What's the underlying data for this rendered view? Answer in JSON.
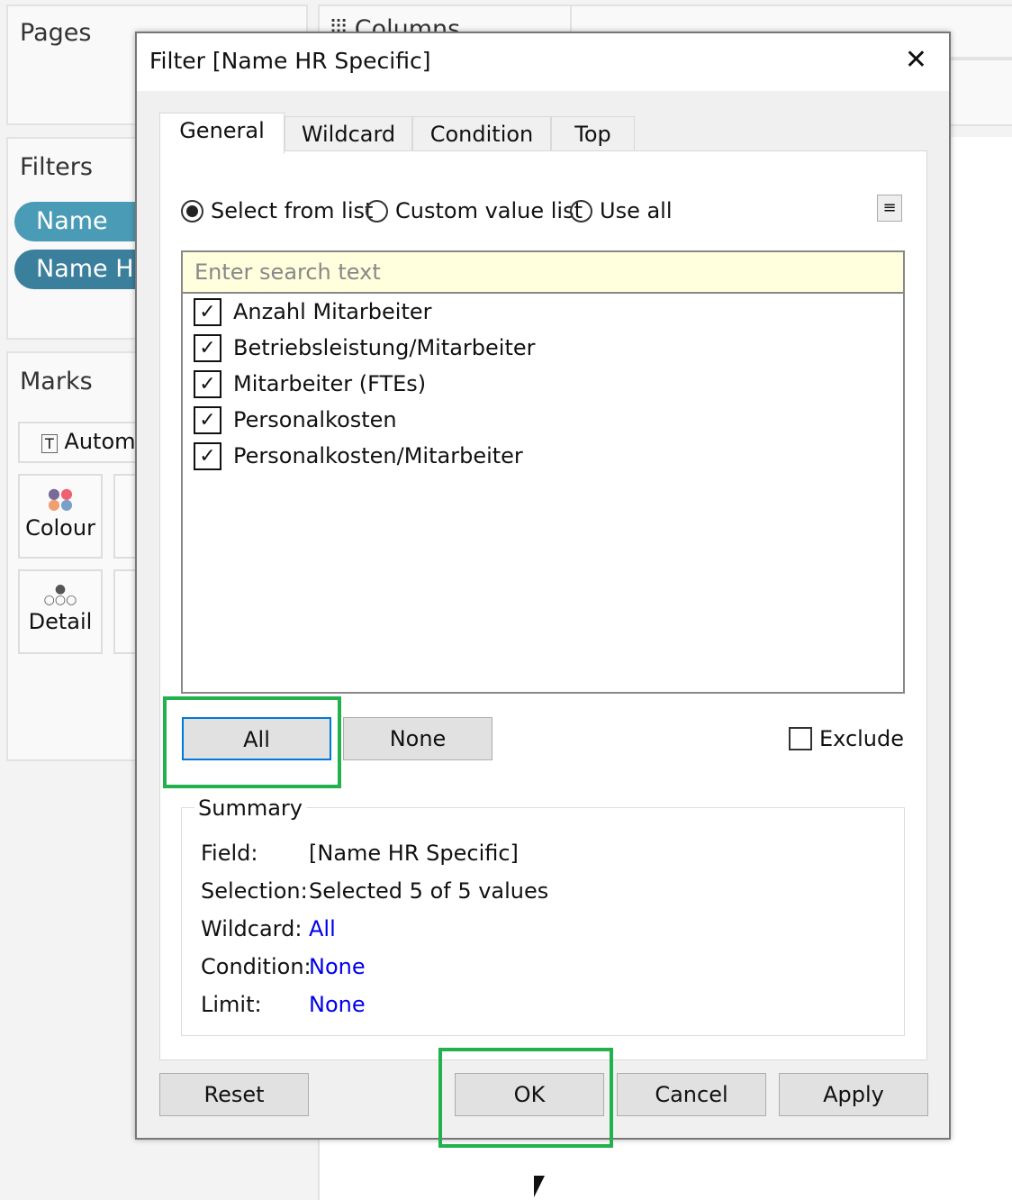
{
  "background": {
    "pages": "Pages",
    "columns": "Columns",
    "filters": "Filters",
    "filter_pills": [
      "Name",
      "Name HR"
    ],
    "marks": "Marks",
    "mark_type": "Automatic",
    "mark_cards": [
      "Colour",
      "Detail"
    ]
  },
  "dialog": {
    "title": "Filter [Name HR Specific]",
    "tabs": [
      "General",
      "Wildcard",
      "Condition",
      "Top"
    ],
    "radios": [
      "Select from list",
      "Custom value list",
      "Use all"
    ],
    "search_placeholder": "Enter search text",
    "items": [
      "Anzahl Mitarbeiter",
      "Betriebsleistung/Mitarbeiter",
      "Mitarbeiter (FTEs)",
      "Personalkosten",
      "Personalkosten/Mitarbeiter"
    ],
    "all_label": "All",
    "none_label": "None",
    "exclude_label": "Exclude",
    "summary": {
      "title": "Summary",
      "rows": [
        {
          "k": "Field:",
          "v": "[Name HR Specific]"
        },
        {
          "k": "Selection:",
          "v": "Selected 5 of 5 values"
        },
        {
          "k": "Wildcard:",
          "v": "All"
        },
        {
          "k": "Condition:",
          "v": "None"
        },
        {
          "k": "Limit:",
          "v": "None"
        }
      ]
    },
    "buttons": {
      "reset": "Reset",
      "ok": "OK",
      "cancel": "Cancel",
      "apply": "Apply"
    }
  },
  "colors": {
    "highlight": "#22b14c",
    "pill1": "#4a9bb5",
    "pill2": "#3a7f9c"
  }
}
